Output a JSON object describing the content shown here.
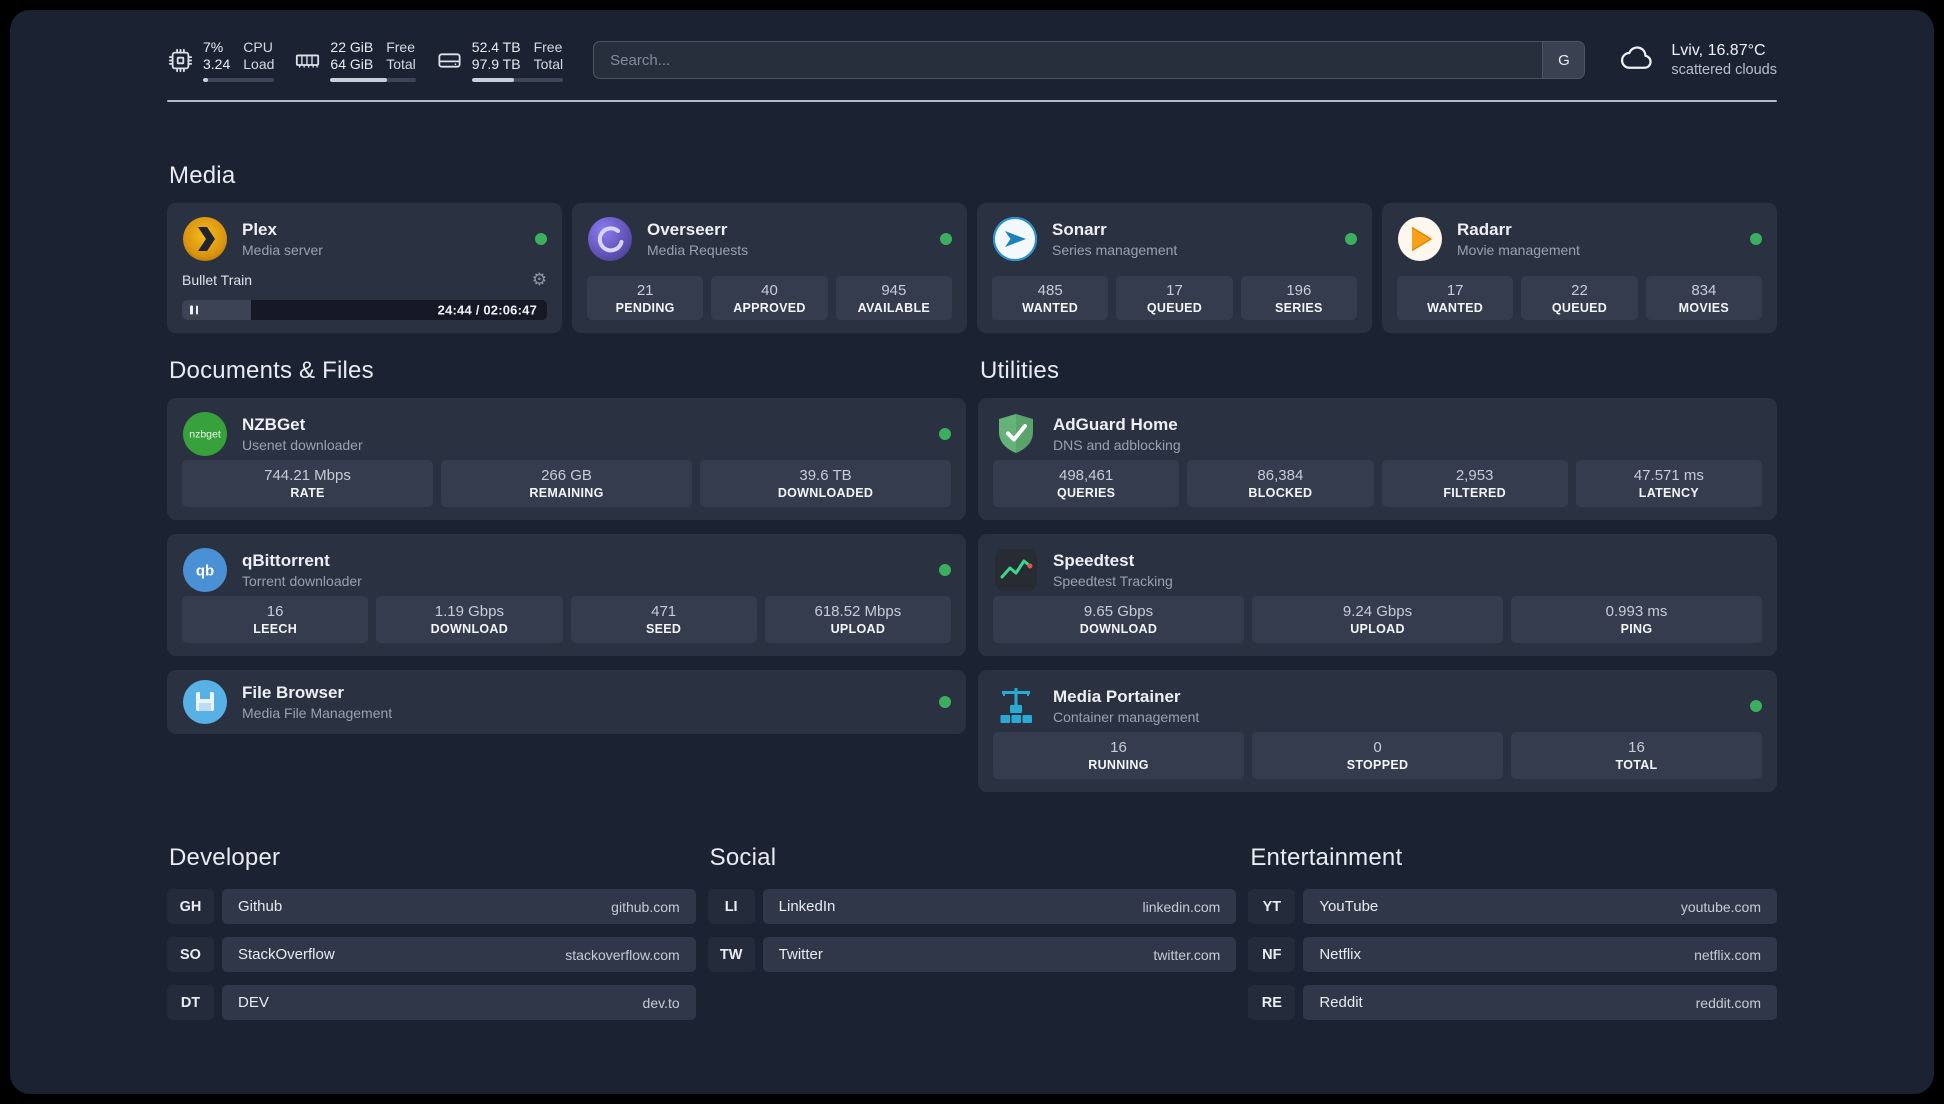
{
  "colors": {
    "panel_background": "#1b2231",
    "card_background": "#2a3140",
    "tile_background": "#353c4d",
    "status_online": "#3bae5f",
    "plex_gold": "#e5a00d",
    "overseerr_purple": "#6c5ce7",
    "sonarr_blue": "#1d82ba",
    "radarr_amber": "#f7a01b",
    "nzbget_green": "#37a23c",
    "qbittorrent_blue": "#4a90d4",
    "filebrowser_blue": "#58b1e4",
    "adguard_green": "#67b279",
    "speedtest_green": "#3dd68c",
    "portainer_blue": "#29aad4"
  },
  "topbar": {
    "cpu": {
      "percent": "7%",
      "load": "3.24",
      "label_line1": "CPU",
      "label_line2": "Load",
      "bar_percent": 7
    },
    "memory": {
      "free": "22 GiB",
      "total": "64 GiB",
      "label_line1": "Free",
      "label_line2": "Total",
      "bar_percent": 66
    },
    "storage": {
      "free": "52.4 TB",
      "total": "97.9 TB",
      "label_line1": "Free",
      "label_line2": "Total",
      "bar_percent": 46
    },
    "search": {
      "placeholder": "Search...",
      "engine_button": "G"
    },
    "weather": {
      "location": "Lviv, 16.87°C",
      "condition": "scattered clouds"
    }
  },
  "media": {
    "title": "Media",
    "plex": {
      "name": "Plex",
      "description": "Media server",
      "status": "online",
      "now_playing": {
        "title": "Bullet Train",
        "time": "24:44 / 02:06:47",
        "progress_percent": 19
      }
    },
    "overseerr": {
      "name": "Overseerr",
      "description": "Media Requests",
      "status": "online",
      "stats": [
        {
          "value": "21",
          "label": "PENDING"
        },
        {
          "value": "40",
          "label": "APPROVED"
        },
        {
          "value": "945",
          "label": "AVAILABLE"
        }
      ]
    },
    "sonarr": {
      "name": "Sonarr",
      "description": "Series management",
      "status": "online",
      "stats": [
        {
          "value": "485",
          "label": "WANTED"
        },
        {
          "value": "17",
          "label": "QUEUED"
        },
        {
          "value": "196",
          "label": "SERIES"
        }
      ]
    },
    "radarr": {
      "name": "Radarr",
      "description": "Movie management",
      "status": "online",
      "stats": [
        {
          "value": "17",
          "label": "WANTED"
        },
        {
          "value": "22",
          "label": "QUEUED"
        },
        {
          "value": "834",
          "label": "MOVIES"
        }
      ]
    }
  },
  "documents": {
    "title": "Documents & Files",
    "nzbget": {
      "name": "NZBGet",
      "description": "Usenet downloader",
      "status": "online",
      "icon_text": "nzbget",
      "stats": [
        {
          "value": "744.21 Mbps",
          "label": "RATE"
        },
        {
          "value": "266 GB",
          "label": "REMAINING"
        },
        {
          "value": "39.6 TB",
          "label": "DOWNLOADED"
        }
      ]
    },
    "qbittorrent": {
      "name": "qBittorrent",
      "description": "Torrent downloader",
      "status": "online",
      "icon_text": "qb",
      "stats": [
        {
          "value": "16",
          "label": "LEECH"
        },
        {
          "value": "1.19 Gbps",
          "label": "DOWNLOAD"
        },
        {
          "value": "471",
          "label": "SEED"
        },
        {
          "value": "618.52 Mbps",
          "label": "UPLOAD"
        }
      ]
    },
    "filebrowser": {
      "name": "File Browser",
      "description": "Media File Management",
      "status": "online"
    }
  },
  "utilities": {
    "title": "Utilities",
    "adguard": {
      "name": "AdGuard Home",
      "description": "DNS and adblocking",
      "stats": [
        {
          "value": "498,461",
          "label": "QUERIES"
        },
        {
          "value": "86,384",
          "label": "BLOCKED"
        },
        {
          "value": "2,953",
          "label": "FILTERED"
        },
        {
          "value": "47.571 ms",
          "label": "LATENCY"
        }
      ]
    },
    "speedtest": {
      "name": "Speedtest",
      "description": "Speedtest Tracking",
      "stats": [
        {
          "value": "9.65 Gbps",
          "label": "DOWNLOAD"
        },
        {
          "value": "9.24 Gbps",
          "label": "UPLOAD"
        },
        {
          "value": "0.993 ms",
          "label": "PING"
        }
      ]
    },
    "portainer": {
      "name": "Media Portainer",
      "description": "Container management",
      "status": "online",
      "stats": [
        {
          "value": "16",
          "label": "RUNNING"
        },
        {
          "value": "0",
          "label": "STOPPED"
        },
        {
          "value": "16",
          "label": "TOTAL"
        }
      ]
    }
  },
  "bookmarks": {
    "developer": {
      "title": "Developer",
      "items": [
        {
          "abbr": "GH",
          "name": "Github",
          "href": "github.com"
        },
        {
          "abbr": "SO",
          "name": "StackOverflow",
          "href": "stackoverflow.com"
        },
        {
          "abbr": "DT",
          "name": "DEV",
          "href": "dev.to"
        }
      ]
    },
    "social": {
      "title": "Social",
      "items": [
        {
          "abbr": "LI",
          "name": "LinkedIn",
          "href": "linkedin.com"
        },
        {
          "abbr": "TW",
          "name": "Twitter",
          "href": "twitter.com"
        }
      ]
    },
    "entertainment": {
      "title": "Entertainment",
      "items": [
        {
          "abbr": "YT",
          "name": "YouTube",
          "href": "youtube.com"
        },
        {
          "abbr": "NF",
          "name": "Netflix",
          "href": "netflix.com"
        },
        {
          "abbr": "RE",
          "name": "Reddit",
          "href": "reddit.com"
        }
      ]
    }
  }
}
